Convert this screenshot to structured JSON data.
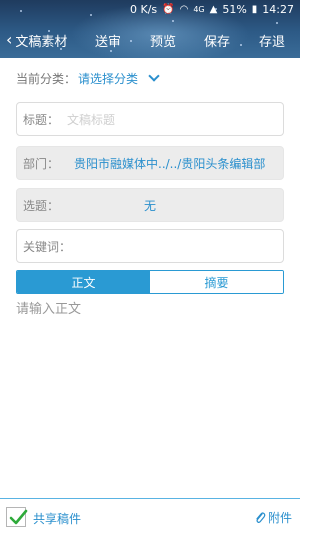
{
  "status_bar": {
    "speed": "0 K/s",
    "network": "4G",
    "battery": "51%",
    "time": "14:27"
  },
  "navbar": {
    "back_label": "文稿素材",
    "send_label": "送审",
    "preview_label": "预览",
    "save_label": "保存",
    "exit_label": "存退"
  },
  "form": {
    "category_label": "当前分类：",
    "category_value": "请选择分类",
    "title_label": "标题：",
    "title_placeholder": "文稿标题",
    "department_label": "部门：",
    "department_value": "贵阳市融媒体中../../贵阳头条编辑部",
    "topic_label": "选题：",
    "topic_value": "无",
    "keyword_label": "关键词："
  },
  "tabs": {
    "body_label": "正文",
    "summary_label": "摘要"
  },
  "editor": {
    "placeholder": "请输入正文"
  },
  "footer": {
    "share_label": "共享稿件",
    "attach_label": "附件"
  },
  "colors": {
    "accent": "#2a9ad3",
    "header_bg": "#2d5a86"
  }
}
